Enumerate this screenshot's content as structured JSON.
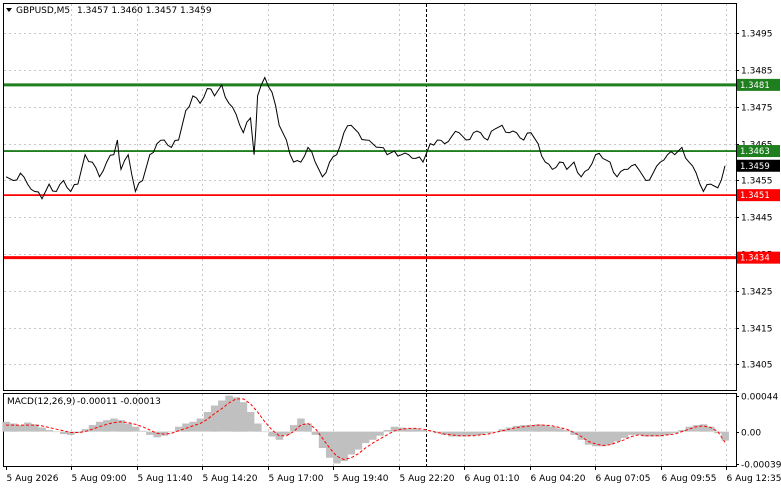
{
  "header": {
    "symbol_timeframe": "GBPUSD,M5",
    "ohlc": "1.3457 1.3460 1.3457 1.3459"
  },
  "macd_header": {
    "title": "MACD(12,26,9)",
    "values": "-0.00011 -0.00013"
  },
  "colors": {
    "support": "#ff0000",
    "resistance": "#1f7f1f",
    "current_price_tag": "#000000",
    "grid": "#c8c8c8",
    "macd_histogram": "#c0c0c0",
    "macd_signal": "#ff0000"
  },
  "chart_data": [
    {
      "type": "line",
      "title": "GBPUSD,M5",
      "ylim": [
        1.3398,
        1.3503
      ],
      "y_ticks": [
        "1.3495",
        "1.3485",
        "1.3475",
        "1.3465",
        "1.3455",
        "1.3445",
        "1.3435",
        "1.3425",
        "1.3415",
        "1.3405"
      ],
      "x_ticks": [
        "5 Aug 2026",
        "5 Aug 09:00",
        "5 Aug 11:40",
        "5 Aug 14:20",
        "5 Aug 17:00",
        "5 Aug 19:40",
        "5 Aug 22:20",
        "6 Aug 01:10",
        "6 Aug 04:20",
        "6 Aug 07:05",
        "6 Aug 09:55",
        "6 Aug 12:35"
      ],
      "horizontal_levels": [
        {
          "value": 1.3481,
          "label": "1.3481",
          "role": "resistance",
          "color": "#1f7f1f"
        },
        {
          "value": 1.3463,
          "label": "1.3463",
          "role": "resistance",
          "color": "#1f7f1f"
        },
        {
          "value": 1.3451,
          "label": "1.3451",
          "role": "support",
          "color": "#ff0000"
        },
        {
          "value": 1.3434,
          "label": "1.3434",
          "role": "support",
          "color": "#ff0000"
        }
      ],
      "current_price": {
        "value": 1.3459,
        "label": "1.3459"
      },
      "series": [
        {
          "values": [
            [
              0.0,
              1.3456
            ],
            [
              0.01,
              1.3455
            ],
            [
              0.02,
              1.3457
            ],
            [
              0.03,
              1.3454
            ],
            [
              0.04,
              1.3452
            ],
            [
              0.05,
              1.345
            ],
            [
              0.06,
              1.3454
            ],
            [
              0.07,
              1.3452
            ],
            [
              0.08,
              1.3455
            ],
            [
              0.09,
              1.3452
            ],
            [
              0.1,
              1.3454
            ],
            [
              0.11,
              1.3462
            ],
            [
              0.12,
              1.346
            ],
            [
              0.13,
              1.3456
            ],
            [
              0.14,
              1.346
            ],
            [
              0.15,
              1.3462
            ],
            [
              0.155,
              1.3466
            ],
            [
              0.16,
              1.3458
            ],
            [
              0.17,
              1.3462
            ],
            [
              0.18,
              1.3452
            ],
            [
              0.19,
              1.3455
            ],
            [
              0.2,
              1.3462
            ],
            [
              0.21,
              1.3465
            ],
            [
              0.22,
              1.3466
            ],
            [
              0.23,
              1.3464
            ],
            [
              0.24,
              1.3466
            ],
            [
              0.25,
              1.3474
            ],
            [
              0.26,
              1.3478
            ],
            [
              0.27,
              1.3476
            ],
            [
              0.28,
              1.348
            ],
            [
              0.29,
              1.3478
            ],
            [
              0.3,
              1.3481
            ],
            [
              0.31,
              1.3476
            ],
            [
              0.32,
              1.3473
            ],
            [
              0.33,
              1.3468
            ],
            [
              0.34,
              1.3472
            ],
            [
              0.345,
              1.3462
            ],
            [
              0.35,
              1.3478
            ],
            [
              0.36,
              1.3483
            ],
            [
              0.37,
              1.3479
            ],
            [
              0.38,
              1.347
            ],
            [
              0.39,
              1.3466
            ],
            [
              0.4,
              1.346
            ],
            [
              0.41,
              1.346
            ],
            [
              0.42,
              1.3464
            ],
            [
              0.43,
              1.346
            ],
            [
              0.44,
              1.3456
            ],
            [
              0.45,
              1.346
            ],
            [
              0.46,
              1.3462
            ],
            [
              0.47,
              1.3468
            ],
            [
              0.48,
              1.347
            ],
            [
              0.49,
              1.3468
            ],
            [
              0.5,
              1.3466
            ],
            [
              0.51,
              1.3465
            ],
            [
              0.52,
              1.3464
            ],
            [
              0.53,
              1.3462
            ],
            [
              0.54,
              1.3463
            ],
            [
              0.55,
              1.3462
            ],
            [
              0.56,
              1.3462
            ],
            [
              0.57,
              1.3461
            ],
            [
              0.58,
              1.346
            ],
            [
              0.59,
              1.3465
            ],
            [
              0.6,
              1.3466
            ],
            [
              0.61,
              1.3465
            ],
            [
              0.62,
              1.3467
            ],
            [
              0.63,
              1.3468
            ],
            [
              0.64,
              1.3466
            ],
            [
              0.65,
              1.3468
            ],
            [
              0.66,
              1.3468
            ],
            [
              0.67,
              1.3466
            ],
            [
              0.68,
              1.3469
            ],
            [
              0.69,
              1.347
            ],
            [
              0.7,
              1.3468
            ],
            [
              0.71,
              1.3468
            ],
            [
              0.72,
              1.3466
            ],
            [
              0.73,
              1.3468
            ],
            [
              0.74,
              1.3465
            ],
            [
              0.75,
              1.346
            ],
            [
              0.76,
              1.3458
            ],
            [
              0.77,
              1.346
            ],
            [
              0.78,
              1.3458
            ],
            [
              0.79,
              1.346
            ],
            [
              0.8,
              1.3456
            ],
            [
              0.81,
              1.3458
            ],
            [
              0.82,
              1.3462
            ],
            [
              0.83,
              1.3461
            ],
            [
              0.84,
              1.346
            ],
            [
              0.85,
              1.3456
            ],
            [
              0.86,
              1.3458
            ],
            [
              0.87,
              1.3459
            ],
            [
              0.88,
              1.3458
            ],
            [
              0.89,
              1.3455
            ],
            [
              0.9,
              1.3457
            ],
            [
              0.91,
              1.346
            ],
            [
              0.92,
              1.3462
            ],
            [
              0.93,
              1.3462
            ],
            [
              0.94,
              1.3464
            ],
            [
              0.95,
              1.346
            ],
            [
              0.96,
              1.3457
            ],
            [
              0.97,
              1.3452
            ],
            [
              0.98,
              1.3454
            ],
            [
              0.99,
              1.3453
            ],
            [
              1.0,
              1.3459
            ]
          ]
        }
      ]
    },
    {
      "type": "bar",
      "title": "MACD(12,26,9)",
      "ylim": [
        -0.00042,
        0.00046
      ],
      "y_ticks": [
        "0.00044",
        "0.00",
        "-0.00039"
      ],
      "series": [
        {
          "kind": "histogram",
          "values": [
            0.00012,
            0.0001,
            8e-05,
            0.00011,
            9e-05,
            5e-05,
            2e-05,
            0.0,
            -3e-05,
            -4e-05,
            -2e-05,
            3e-05,
            8e-05,
            0.00012,
            0.00014,
            0.00016,
            0.00014,
            0.0001,
            6e-05,
            1e-05,
            -4e-05,
            -7e-05,
            -5e-05,
            0.0,
            6e-05,
            0.0001,
            0.00012,
            0.00016,
            0.00024,
            0.00032,
            0.00038,
            0.00044,
            0.00042,
            0.00036,
            0.00024,
            0.0001,
            0.0,
            -6e-05,
            -0.0001,
            -4e-05,
            8e-05,
            0.00016,
            0.0001,
            -4e-05,
            -0.0002,
            -0.00032,
            -0.00039,
            -0.00036,
            -0.00028,
            -0.00022,
            -0.00014,
            -0.0001,
            -5e-05,
            2e-05,
            6e-05,
            5e-05,
            4e-05,
            4e-05,
            2e-05,
            0.0,
            -2e-05,
            -4e-05,
            -6e-05,
            -6e-05,
            -6e-05,
            -5e-05,
            -4e-05,
            -2e-05,
            0.0,
            3e-05,
            5e-05,
            7e-05,
            8e-05,
            8e-05,
            9e-05,
            8e-05,
            6e-05,
            4e-05,
            2e-05,
            -4e-05,
            -0.0001,
            -0.00016,
            -0.00018,
            -0.00018,
            -0.00016,
            -0.00012,
            -8e-05,
            -4e-05,
            -4e-05,
            -6e-05,
            -6e-05,
            -6e-05,
            -4e-05,
            -2e-05,
            2e-05,
            6e-05,
            8e-05,
            9e-05,
            6e-05,
            -2e-05,
            -0.00011
          ]
        },
        {
          "kind": "signal",
          "values": [
            8e-05,
            8e-05,
            8e-05,
            8e-05,
            8e-05,
            7e-05,
            5e-05,
            3e-05,
            1e-05,
            -1e-05,
            -1e-05,
            0.0,
            3e-05,
            6e-05,
            9e-05,
            0.00011,
            0.00012,
            0.00011,
            9e-05,
            6e-05,
            2e-05,
            -2e-05,
            -3e-05,
            -2e-05,
            1e-05,
            4e-05,
            7e-05,
            0.0001,
            0.00015,
            0.00022,
            0.00028,
            0.00035,
            0.0004,
            0.0004,
            0.00034,
            0.00024,
            0.00012,
            2e-05,
            -5e-05,
            -5e-05,
            0.0,
            8e-05,
            0.0001,
            4e-05,
            -8e-05,
            -0.0002,
            -0.0003,
            -0.00034,
            -0.00032,
            -0.00027,
            -0.0002,
            -0.00014,
            -9e-05,
            -4e-05,
            1e-05,
            3e-05,
            4e-05,
            4e-05,
            3e-05,
            1e-05,
            -1e-05,
            -3e-05,
            -4e-05,
            -5e-05,
            -5e-05,
            -5e-05,
            -4e-05,
            -3e-05,
            -1e-05,
            1e-05,
            3e-05,
            5e-05,
            6e-05,
            7e-05,
            8e-05,
            8e-05,
            7e-05,
            5e-05,
            3e-05,
            -1e-05,
            -6e-05,
            -0.00012,
            -0.00015,
            -0.00017,
            -0.00016,
            -0.00013,
            -0.0001,
            -6e-05,
            -4e-05,
            -5e-05,
            -5e-05,
            -5e-05,
            -4e-05,
            -3e-05,
            0.0,
            3e-05,
            6e-05,
            7e-05,
            5e-05,
            0.0,
            -0.00013
          ]
        }
      ]
    }
  ]
}
